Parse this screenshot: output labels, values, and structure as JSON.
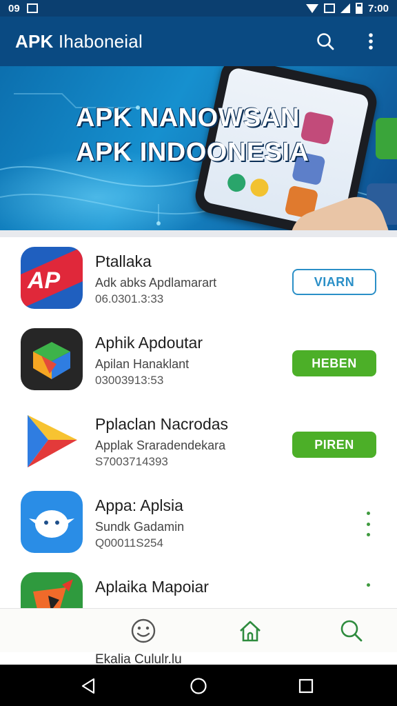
{
  "status_bar": {
    "time_left": "09",
    "time_right": "7:00"
  },
  "app_bar": {
    "title_bold": "APK",
    "title_rest": " Ihaboneial",
    "search_icon": "search-icon",
    "menu_icon": "more-vert-icon"
  },
  "banner": {
    "line1": "APK NANOWSAN",
    "line2": "APK INDOONESIA"
  },
  "apps": [
    {
      "name": "Ptallaka",
      "developer": "Adk abks Apdlamarart",
      "size": "06.0301.3:33",
      "action": "VIARN",
      "action_style": "outline"
    },
    {
      "name": "Aphik Apdoutar",
      "developer": "Apilan Hanaklant",
      "size": "03003913:53",
      "action": "HEBEN",
      "action_style": "green"
    },
    {
      "name": "Pplaclan Nacrodas",
      "developer": "Applak Sraradendekara",
      "size": "S7003714393",
      "action": "PIREN",
      "action_style": "green"
    },
    {
      "name": "Appa: Aplsia",
      "developer": "Sundk Gadamin",
      "size": "Q00011S254",
      "action": "",
      "action_style": "menu"
    },
    {
      "name": "Aplaika Mapoiar",
      "developer": "",
      "size": "",
      "action": "",
      "action_style": "menu"
    }
  ],
  "peek_text": "Ekalia Cululr.lu",
  "bottom_nav": [
    "emoji-icon",
    "home-icon",
    "search-icon"
  ],
  "system_nav": [
    "back-icon",
    "home-circle-icon",
    "recents-icon"
  ],
  "colors": {
    "appbar": "#0a4a82",
    "accent_green": "#4caf28",
    "accent_blue": "#2a8fc7"
  }
}
